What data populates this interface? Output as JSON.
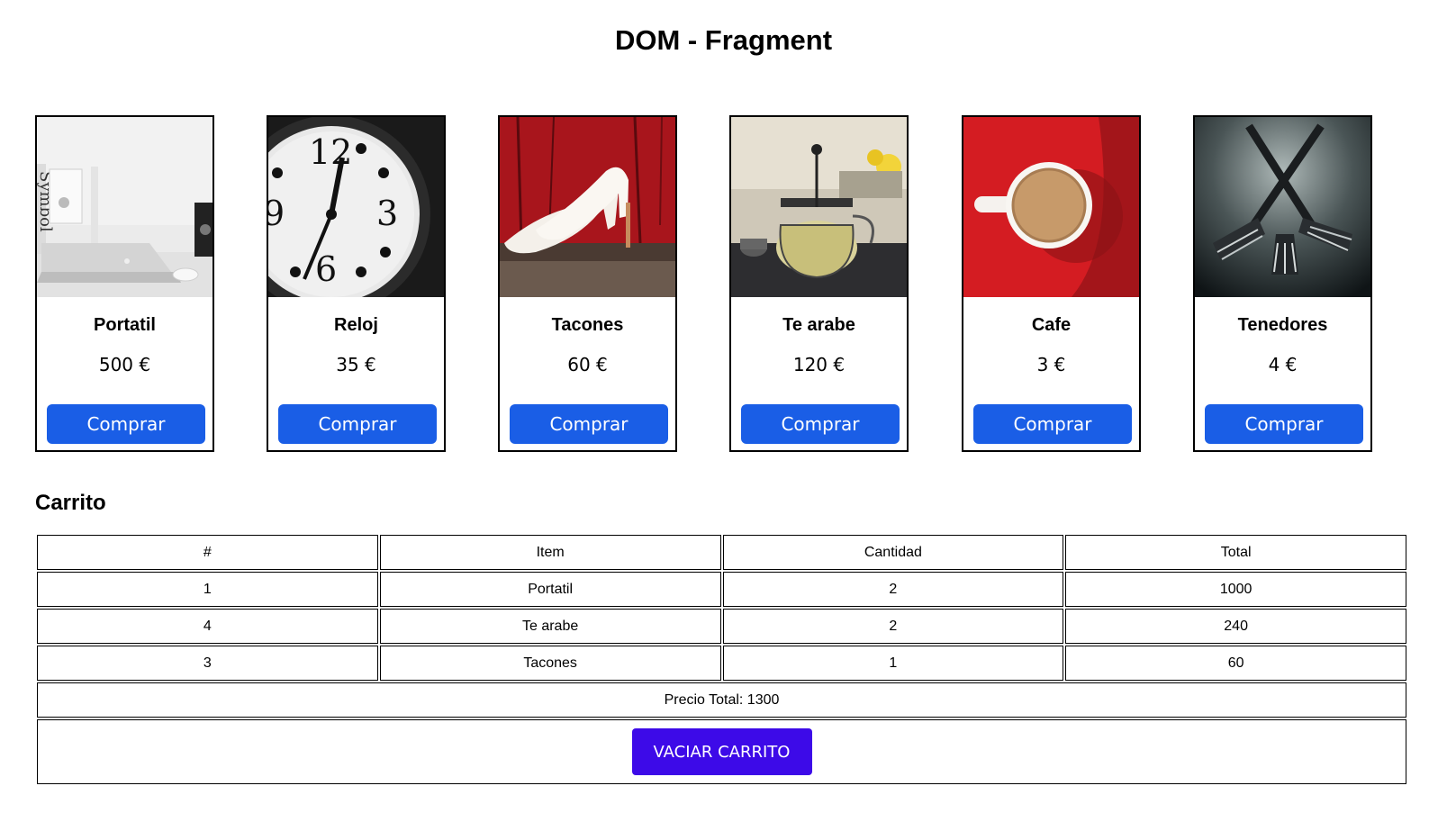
{
  "page": {
    "title": "DOM - Fragment"
  },
  "products": [
    {
      "name": "Portatil",
      "price": "500 €",
      "button": "Comprar",
      "image": "laptop-photo"
    },
    {
      "name": "Reloj",
      "price": "35 €",
      "button": "Comprar",
      "image": "clock-photo"
    },
    {
      "name": "Tacones",
      "price": "60 €",
      "button": "Comprar",
      "image": "heels-photo"
    },
    {
      "name": "Te arabe",
      "price": "120 €",
      "button": "Comprar",
      "image": "teapot-photo"
    },
    {
      "name": "Cafe",
      "price": "3 €",
      "button": "Comprar",
      "image": "coffee-photo"
    },
    {
      "name": "Tenedores",
      "price": "4 €",
      "button": "Comprar",
      "image": "forks-photo"
    }
  ],
  "cart": {
    "heading": "Carrito",
    "headers": [
      "#",
      "Item",
      "Cantidad",
      "Total"
    ],
    "rows": [
      [
        "1",
        "Portatil",
        "2",
        "1000"
      ],
      [
        "4",
        "Te arabe",
        "2",
        "240"
      ],
      [
        "3",
        "Tacones",
        "1",
        "60"
      ]
    ],
    "total_label": "Precio Total: 1300",
    "empty_button": "VACIAR CARRITO"
  },
  "colors": {
    "buy_button": "#1a5ee6",
    "empty_button": "#3d0ae8"
  }
}
